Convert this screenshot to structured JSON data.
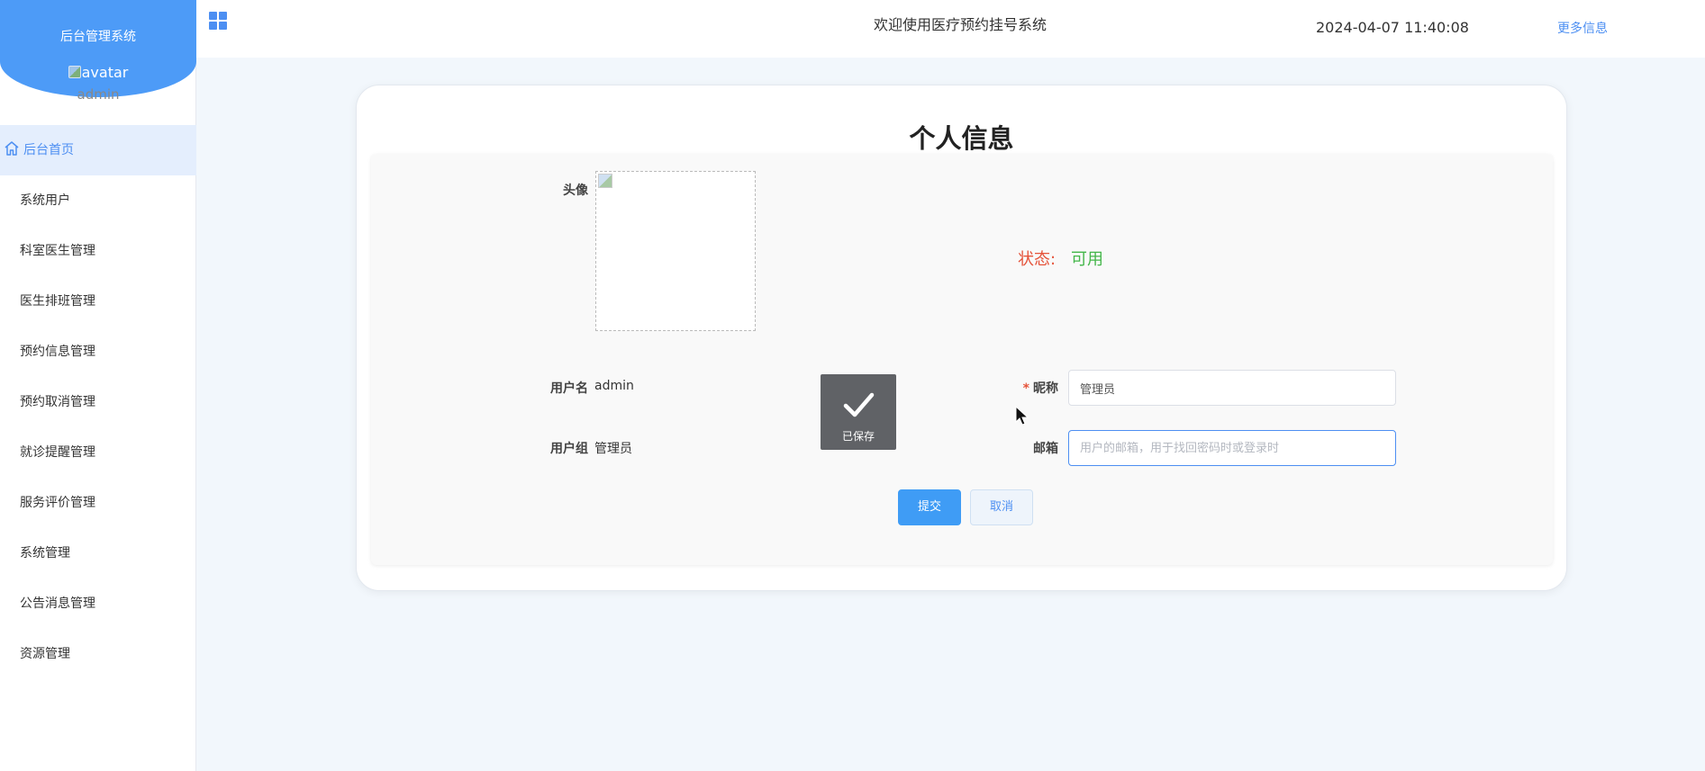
{
  "sidebar": {
    "brand_title": "后台管理系统",
    "avatar_alt": "avatar",
    "username": "admin",
    "items": [
      {
        "label": "后台首页",
        "icon": "home-icon"
      },
      {
        "label": "系统用户"
      },
      {
        "label": "科室医生管理"
      },
      {
        "label": "医生排班管理"
      },
      {
        "label": "预约信息管理"
      },
      {
        "label": "预约取消管理"
      },
      {
        "label": "就诊提醒管理"
      },
      {
        "label": "服务评价管理"
      },
      {
        "label": "系统管理"
      },
      {
        "label": "公告消息管理"
      },
      {
        "label": "资源管理"
      }
    ]
  },
  "header": {
    "title": "欢迎使用医疗预约挂号系统",
    "datetime": "2024-04-07 11:40:08",
    "more_link": "更多信息",
    "menu_icon": "grid-icon"
  },
  "page": {
    "title": "个人信息",
    "avatar_label": "头像",
    "status_label": "状态:",
    "status_value": "可用",
    "username_label": "用户名",
    "username_value": "admin",
    "usergroup_label": "用户组",
    "usergroup_value": "管理员",
    "nickname_label": "昵称",
    "nickname_value": "管理员",
    "email_label": "邮箱",
    "email_placeholder": "用户的邮箱，用于找回密码时或登录时",
    "email_value": "",
    "submit_label": "提交",
    "cancel_label": "取消"
  },
  "toast": {
    "text": "已保存",
    "icon": "check-icon"
  },
  "colors": {
    "accent": "#4d8ff2",
    "brand": "#4d9bf7",
    "status_label": "#e5533a",
    "status_value": "#43b649"
  }
}
